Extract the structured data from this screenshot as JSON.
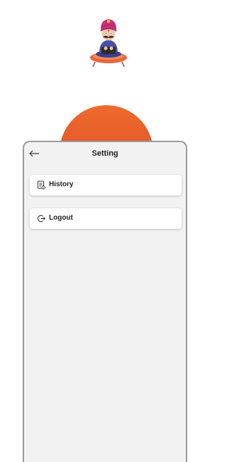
{
  "header": {
    "title": "Setting",
    "back_icon": "back-arrow-icon"
  },
  "menu": {
    "items": [
      {
        "label": "History",
        "icon": "history-document-icon"
      },
      {
        "label": "Logout",
        "icon": "logout-icon"
      }
    ]
  },
  "colors": {
    "accent_orange": "#e85a2a",
    "panel_background": "#f2f2f2",
    "panel_border": "#9a9a9a",
    "item_background": "#ffffff"
  }
}
